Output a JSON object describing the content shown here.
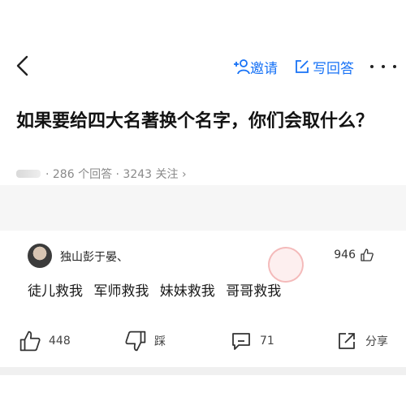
{
  "header": {
    "invite_label": "邀请",
    "write_label": "写回答"
  },
  "question": {
    "title": "如果要给四大名著换个名字，你们会取什么？",
    "meta": "· 286 个回答 · 3243 关注 ›"
  },
  "answer": {
    "author": "独山彭于晏、",
    "likes": "946",
    "text": "徒儿救我 军师救我 妹妹救我 哥哥救我"
  },
  "actions": {
    "like_count": "448",
    "dislike_label": "踩",
    "comment_count": "71",
    "share_label": "分享"
  },
  "colors": {
    "accent": "#1772f6",
    "muted": "#8a8a8a",
    "band": "#f6f6f6"
  }
}
